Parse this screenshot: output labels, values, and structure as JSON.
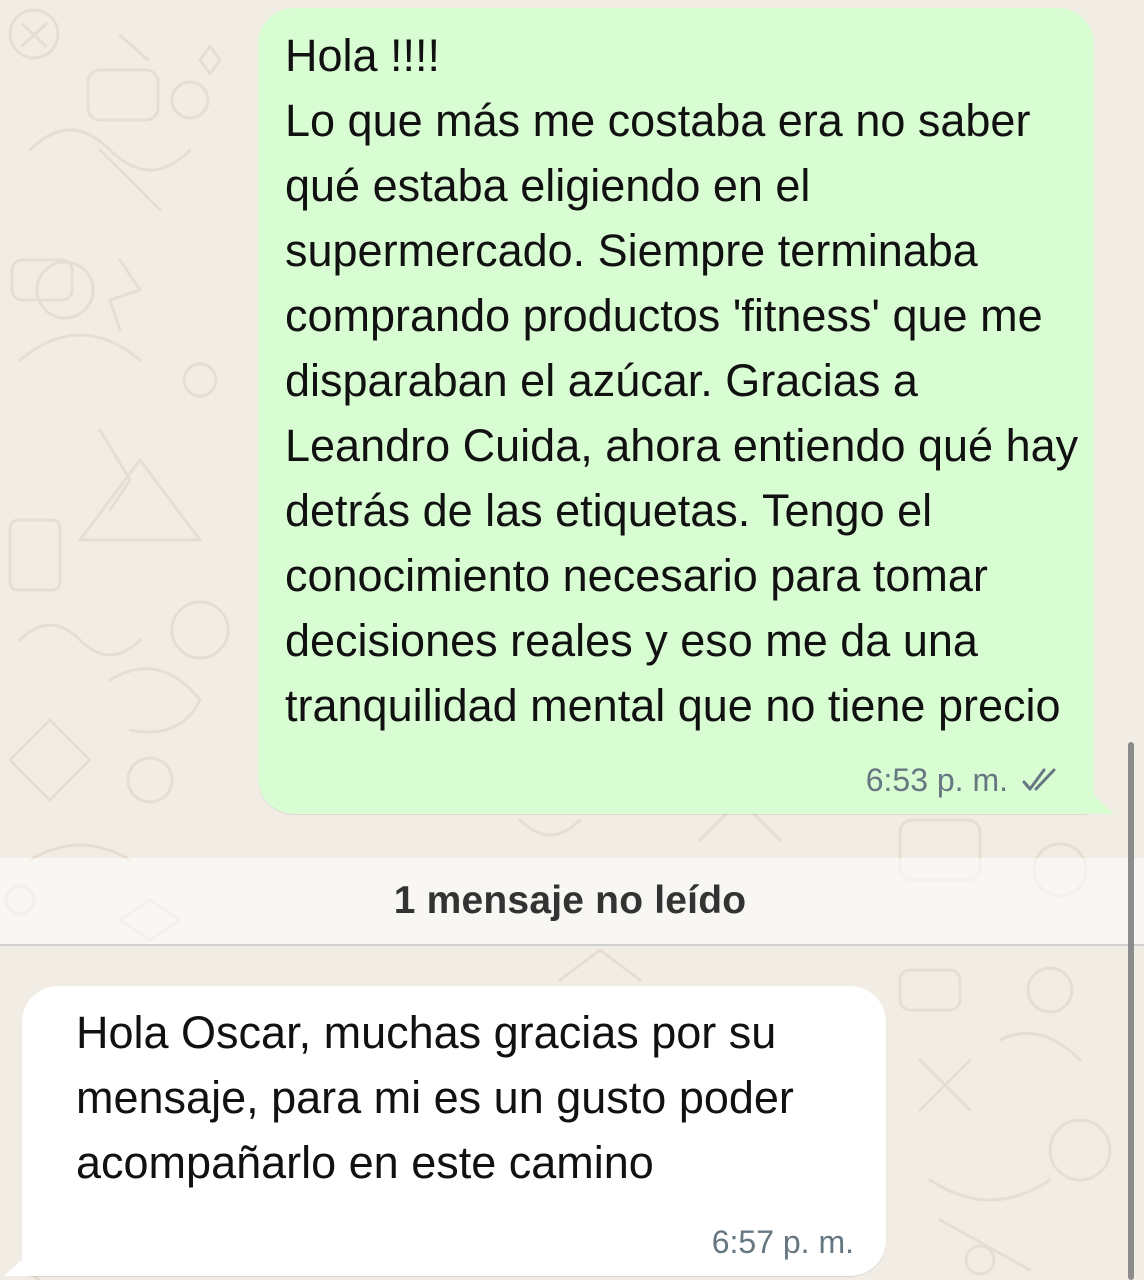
{
  "chat": {
    "background_color": "#f2ede4",
    "outgoing_bubble_color": "#d9fdd3",
    "incoming_bubble_color": "#ffffff",
    "messages": [
      {
        "direction": "outgoing",
        "text": "Hola !!!!\nLo que más me costaba era no saber qué estaba eligiendo en el supermercado. Siempre terminaba comprando productos 'fitness' que me disparaban el azúcar. Gracias a Leandro Cuida, ahora entiendo qué hay detrás de las etiquetas. Tengo el conocimiento necesario para tomar decisiones reales y eso me da una tranquilidad mental que no tiene precio",
        "time": "6:53 p. m.",
        "status_icon": "double-check-icon"
      },
      {
        "direction": "incoming",
        "text": "Hola Oscar, muchas gracias por su mensaje, para mi es un gusto poder acompañarlo en este camino",
        "time": "6:57 p. m."
      }
    ],
    "unread_divider": "1 mensaje no leído"
  }
}
